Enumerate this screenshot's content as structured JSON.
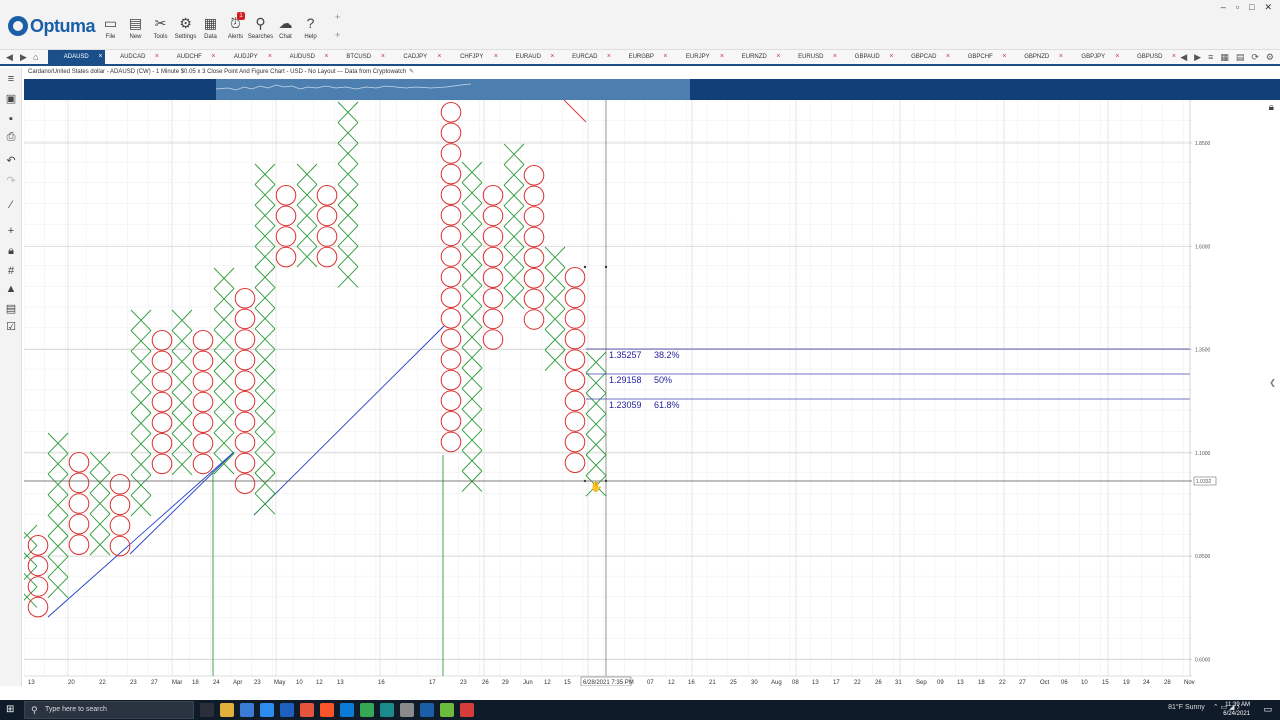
{
  "app": {
    "name": "Optuma",
    "brand_color": "#1b5ea8"
  },
  "toolbar": [
    {
      "label": "File",
      "icon": "folder-icon"
    },
    {
      "label": "New",
      "icon": "new-chart-icon"
    },
    {
      "label": "Tools",
      "icon": "tools-icon"
    },
    {
      "label": "Settings",
      "icon": "gear-icon"
    },
    {
      "label": "Data",
      "icon": "data-icon"
    },
    {
      "label": "Alerts",
      "icon": "alarm-icon",
      "badge": "1"
    },
    {
      "label": "Searches",
      "icon": "search-icon"
    },
    {
      "label": "Chat",
      "icon": "chat-icon"
    },
    {
      "label": "Help",
      "icon": "help-icon"
    }
  ],
  "tabs": [
    "ADAUSD",
    "AUDCAD",
    "AUDCHF",
    "AUDJPY",
    "AUDUSD",
    "BTCUSD",
    "CADJPY",
    "CHFJPY",
    "EURAUD",
    "EURCAD",
    "EURGBP",
    "EURJPY",
    "EURNZD",
    "EURUSD",
    "GBPAUD",
    "GBPCAD",
    "GBPCHF",
    "GBPNZD",
    "GBPJPY",
    "GBPUSD"
  ],
  "active_tab": 0,
  "chart": {
    "info": "Cardano/United States dollar - ADAUSD (CW) - 1 Minute $0.05 x 3 Close Point And Figure Chart - USD - No Layout --- Data from Cryptowatch",
    "price_labels": [
      "1.8500",
      "1.6000",
      "1.3500",
      "1.1000",
      "0.8500",
      "0.6000"
    ],
    "current_price": "1.0332",
    "fib_levels": [
      {
        "price": "1.35257",
        "pct": "38.2%"
      },
      {
        "price": "1.29158",
        "pct": "50%"
      },
      {
        "price": "1.23059",
        "pct": "61.8%"
      }
    ],
    "cursor_date": "6/28/2021 7:35 PM",
    "date_labels": [
      "13",
      "20",
      "22",
      "23",
      "27",
      "Mar",
      "18",
      "24",
      "Apr",
      "23",
      "May",
      "10",
      "12",
      "13",
      "16",
      "17",
      "23",
      "26",
      "29",
      "Jun",
      "12",
      "15",
      "07",
      "12",
      "16",
      "21",
      "25",
      "30",
      "Aug",
      "08",
      "13",
      "17",
      "22",
      "26",
      "31",
      "Sep",
      "09",
      "13",
      "18",
      "22",
      "27",
      "Oct",
      "06",
      "10",
      "15",
      "19",
      "24",
      "28",
      "Nov"
    ],
    "x_color": "#2e9b3a",
    "o_color": "#d93030",
    "trend_color": "#2340c8"
  },
  "taskbar": {
    "search_placeholder": "Type here to search",
    "weather": "81°F  Sunny",
    "time": "11:39 AM",
    "date": "6/24/2021"
  }
}
